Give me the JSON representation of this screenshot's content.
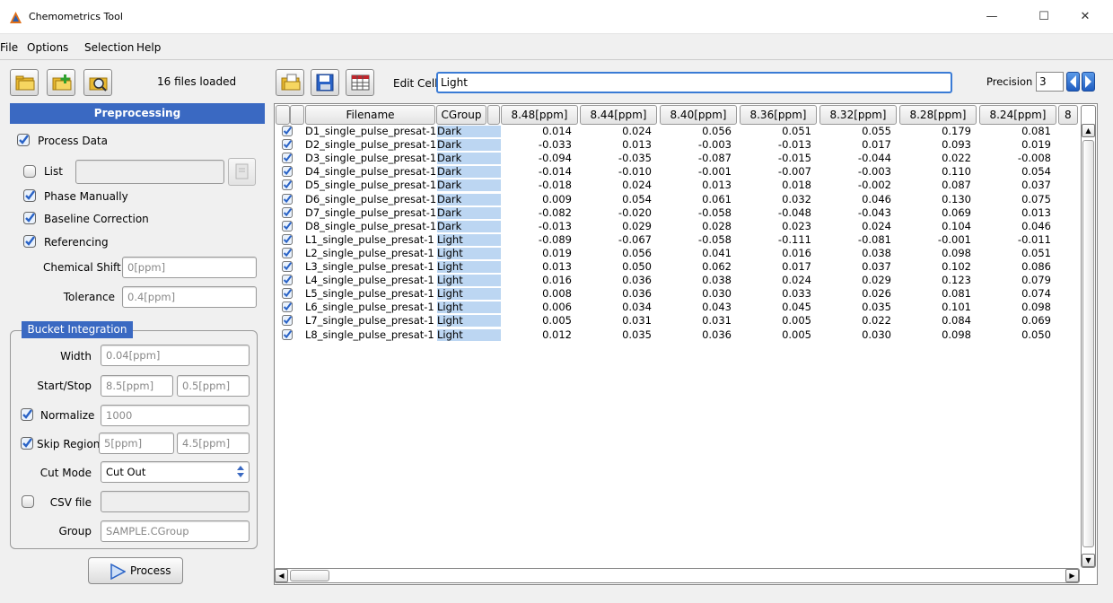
{
  "window": {
    "title": "Chemometrics Tool",
    "minimize": "—",
    "maximize": "☐",
    "close": "✕"
  },
  "menu": [
    "File",
    "Options",
    "Selection",
    "Help"
  ],
  "left_toolbar": {
    "status": "16 files loaded"
  },
  "preprocessing": {
    "title": "Preprocessing",
    "process_data": {
      "label": "Process Data",
      "checked": true
    },
    "list": {
      "label": "List",
      "value": "",
      "checked": false
    },
    "phase_manually": {
      "label": "Phase Manually",
      "checked": true
    },
    "baseline_correction": {
      "label": "Baseline Correction",
      "checked": true
    },
    "referencing": {
      "label": "Referencing",
      "checked": true
    },
    "chemical_shift": {
      "label": "Chemical Shift",
      "value": "0[ppm]"
    },
    "tolerance": {
      "label": "Tolerance",
      "value": "0.4[ppm]"
    },
    "bucket": {
      "title": "Bucket Integration",
      "width": {
        "label": "Width",
        "value": "0.04[ppm]"
      },
      "start_stop": {
        "label": "Start/Stop",
        "start": "8.5[ppm]",
        "stop": "0.5[ppm]"
      },
      "normalize": {
        "label": "Normalize",
        "value": "1000",
        "checked": true
      },
      "skip_region": {
        "label": "Skip Region",
        "from": "5[ppm]",
        "to": "4.5[ppm]",
        "checked": true
      },
      "cut_mode": {
        "label": "Cut Mode",
        "value": "Cut Out"
      },
      "csv_file": {
        "label": "CSV file",
        "value": "",
        "checked": false
      },
      "group": {
        "label": "Group",
        "value": "SAMPLE.CGroup"
      }
    },
    "process_button": "Process"
  },
  "edit_cell": {
    "label": "Edit Cell",
    "value": "Light"
  },
  "precision": {
    "label": "Precision",
    "value": "3"
  },
  "table": {
    "headers": [
      "Filename",
      "CGroup",
      "8.48[ppm]",
      "8.44[ppm]",
      "8.40[ppm]",
      "8.36[ppm]",
      "8.32[ppm]",
      "8.28[ppm]",
      "8.24[ppm]",
      "8"
    ],
    "rows": [
      [
        "D1_single_pulse_presat-1",
        "Dark",
        "0.014",
        "0.024",
        "0.056",
        "0.051",
        "0.055",
        "0.179",
        "0.081"
      ],
      [
        "D2_single_pulse_presat-1",
        "Dark",
        "-0.033",
        "0.013",
        "-0.003",
        "-0.013",
        "0.017",
        "0.093",
        "0.019"
      ],
      [
        "D3_single_pulse_presat-1",
        "Dark",
        "-0.094",
        "-0.035",
        "-0.087",
        "-0.015",
        "-0.044",
        "0.022",
        "-0.008"
      ],
      [
        "D4_single_pulse_presat-1",
        "Dark",
        "-0.014",
        "-0.010",
        "-0.001",
        "-0.007",
        "-0.003",
        "0.110",
        "0.054"
      ],
      [
        "D5_single_pulse_presat-1",
        "Dark",
        "-0.018",
        "0.024",
        "0.013",
        "0.018",
        "-0.002",
        "0.087",
        "0.037"
      ],
      [
        "D6_single_pulse_presat-1",
        "Dark",
        "0.009",
        "0.054",
        "0.061",
        "0.032",
        "0.046",
        "0.130",
        "0.075"
      ],
      [
        "D7_single_pulse_presat-1",
        "Dark",
        "-0.082",
        "-0.020",
        "-0.058",
        "-0.048",
        "-0.043",
        "0.069",
        "0.013"
      ],
      [
        "D8_single_pulse_presat-1",
        "Dark",
        "-0.013",
        "0.029",
        "0.028",
        "0.023",
        "0.024",
        "0.104",
        "0.046"
      ],
      [
        "L1_single_pulse_presat-1",
        "Light",
        "-0.089",
        "-0.067",
        "-0.058",
        "-0.111",
        "-0.081",
        "-0.001",
        "-0.011"
      ],
      [
        "L2_single_pulse_presat-1",
        "Light",
        "0.019",
        "0.056",
        "0.041",
        "0.016",
        "0.038",
        "0.098",
        "0.051"
      ],
      [
        "L3_single_pulse_presat-1",
        "Light",
        "0.013",
        "0.050",
        "0.062",
        "0.017",
        "0.037",
        "0.102",
        "0.086"
      ],
      [
        "L4_single_pulse_presat-1",
        "Light",
        "0.016",
        "0.036",
        "0.038",
        "0.024",
        "0.029",
        "0.123",
        "0.079"
      ],
      [
        "L5_single_pulse_presat-1",
        "Light",
        "0.008",
        "0.036",
        "0.030",
        "0.033",
        "0.026",
        "0.081",
        "0.074"
      ],
      [
        "L6_single_pulse_presat-1",
        "Light",
        "0.006",
        "0.034",
        "0.043",
        "0.045",
        "0.035",
        "0.101",
        "0.098"
      ],
      [
        "L7_single_pulse_presat-1",
        "Light",
        "0.005",
        "0.031",
        "0.031",
        "0.005",
        "0.022",
        "0.084",
        "0.069"
      ],
      [
        "L8_single_pulse_presat-1",
        "Light",
        "0.012",
        "0.035",
        "0.036",
        "0.005",
        "0.030",
        "0.098",
        "0.050"
      ]
    ]
  },
  "colors": {
    "accent": "#3a69c2",
    "group_highlight": "#bcd6f2",
    "focus": "#3a7bd5"
  }
}
